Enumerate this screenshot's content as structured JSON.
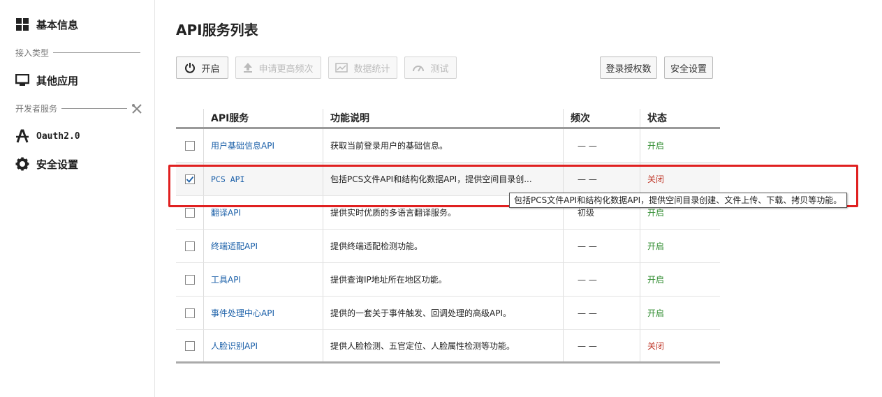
{
  "sidebar": {
    "basic_info": "基本信息",
    "section_access": "接入类型",
    "other_apps": "其他应用",
    "section_dev": "开发者服务",
    "oauth": "Oauth2.0",
    "security": "安全设置"
  },
  "page_title": "API服务列表",
  "toolbar": {
    "open": "开启",
    "apply_higher": "申请更高频次",
    "stats": "数据统计",
    "test": "测试",
    "login_auth": "登录授权数",
    "security": "安全设置"
  },
  "table": {
    "headers": [
      "API服务",
      "功能说明",
      "频次",
      "状态"
    ],
    "rows": [
      {
        "name": "用户基础信息API",
        "desc": "获取当前登录用户的基础信息。",
        "freq": "— —",
        "status": "开启",
        "checked": false
      },
      {
        "name": "PCS API",
        "desc": "包括PCS文件API和结构化数据API，提供空间目录创...",
        "freq": "— —",
        "status": "关闭",
        "checked": true
      },
      {
        "name": "翻译API",
        "desc": "提供实时优质的多语言翻译服务。",
        "freq": "初级",
        "status": "开启",
        "checked": false
      },
      {
        "name": "终端适配API",
        "desc": "提供终端适配检测功能。",
        "freq": "— —",
        "status": "开启",
        "checked": false
      },
      {
        "name": "工具API",
        "desc": "提供查询IP地址所在地区功能。",
        "freq": "— —",
        "status": "开启",
        "checked": false
      },
      {
        "name": "事件处理中心API",
        "desc": "提供的一套关于事件触发、回调处理的高级API。",
        "freq": "— —",
        "status": "开启",
        "checked": false
      },
      {
        "name": "人脸识别API",
        "desc": "提供人脸检测、五官定位、人脸属性检测等功能。",
        "freq": "— —",
        "status": "关闭",
        "checked": false
      }
    ]
  },
  "tooltip": "包括PCS文件API和结构化数据API，提供空间目录创建、文件上传、下载、拷贝等功能。",
  "colors": {
    "status_on": "#2e8b2e",
    "status_off": "#c0392b",
    "highlight": "#e02020",
    "link": "#1a5fa8"
  }
}
